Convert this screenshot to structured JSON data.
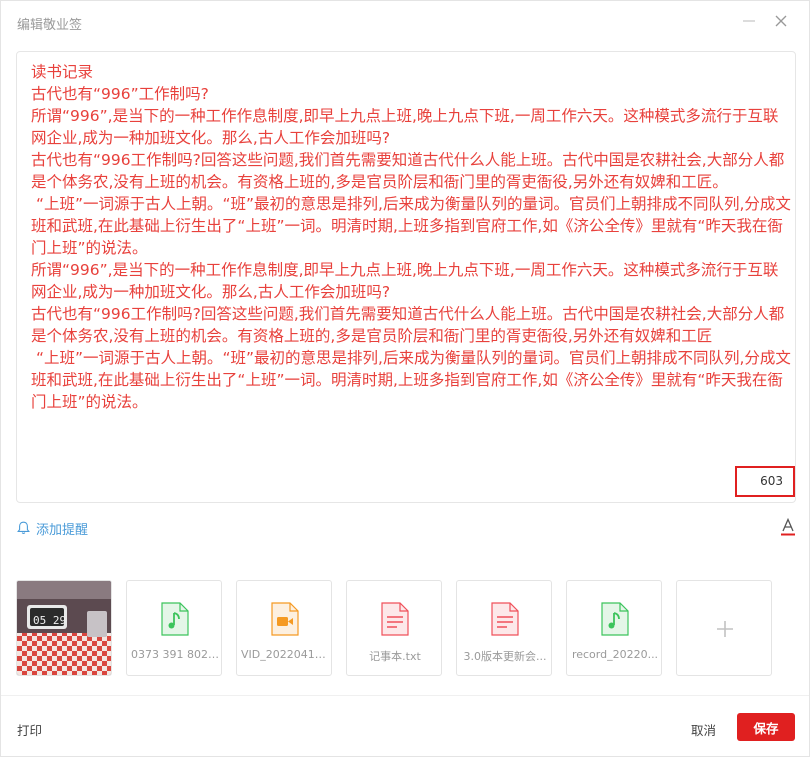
{
  "window": {
    "title": "编辑敬业签"
  },
  "editor": {
    "content": "读书记录\n古代也有“996”工作制吗?\n所谓“996”,是当下的一种工作作息制度,即早上九点上班,晚上九点下班,一周工作六天。这种模式多流行于互联网企业,成为一种加班文化。那么,古人工作会加班吗?\n古代也有“996工作制吗?回答这些问题,我们首先需要知道古代什么人能上班。古代中国是农耕社会,大部分人都是个体务农,没有上班的机会。有资格上班的,多是官员阶层和衙门里的胥吏衙役,另外还有奴婢和工匠。\n “上班”一词源于古人上朝。“班”最初的意思是排列,后来成为衡量队列的量词。官员们上朝排成不同队列,分成文班和武班,在此基础上衍生出了“上班”一词。明清时期,上班多指到官府工作,如《济公全传》里就有“昨天我在衙门上班”的说法。\n所谓“996”,是当下的一种工作作息制度,即早上九点上班,晚上九点下班,一周工作六天。这种模式多流行于互联网企业,成为一种加班文化。那么,古人工作会加班吗?\n古代也有“996工作制吗?回答这些问题,我们首先需要知道古代什么人能上班。古代中国是农耕社会,大部分人都是个体务农,没有上班的机会。有资格上班的,多是官员阶层和衙门里的胥吏衙役,另外还有奴婢和工匠\n “上班”一词源于古人上朝。“班”最初的意思是排列,后来成为衡量队列的量词。官员们上朝排成不同队列,分成文班和武班,在此基础上衍生出了“上班”一词。明清时期,上班多指到官府工作,如《济公全传》里就有“昨天我在衙门上班”的说法。",
    "text_color": "#e8413c",
    "char_count": "603"
  },
  "reminder": {
    "label": "添加提醒"
  },
  "attachments": [
    {
      "type": "image",
      "name": "",
      "photo_clock": "05 29"
    },
    {
      "type": "audio",
      "name": "0373 391 8023...",
      "icon": "music-file-icon",
      "color": "#3cc45c"
    },
    {
      "type": "video",
      "name": "VID_20220415...",
      "icon": "video-file-icon",
      "color": "#f59a23"
    },
    {
      "type": "text",
      "name": "记事本.txt",
      "icon": "text-file-icon",
      "color": "#f0505a"
    },
    {
      "type": "text",
      "name": "3.0版本更新会...",
      "icon": "document-file-icon",
      "color": "#f0505a"
    },
    {
      "type": "audio",
      "name": "record_20220...",
      "icon": "music-file-icon",
      "color": "#3cc45c"
    }
  ],
  "footer": {
    "print_label": "打印",
    "cancel_label": "取消",
    "save_label": "保存"
  },
  "colors": {
    "accent": "#e02020",
    "link": "#4a9bd8"
  }
}
